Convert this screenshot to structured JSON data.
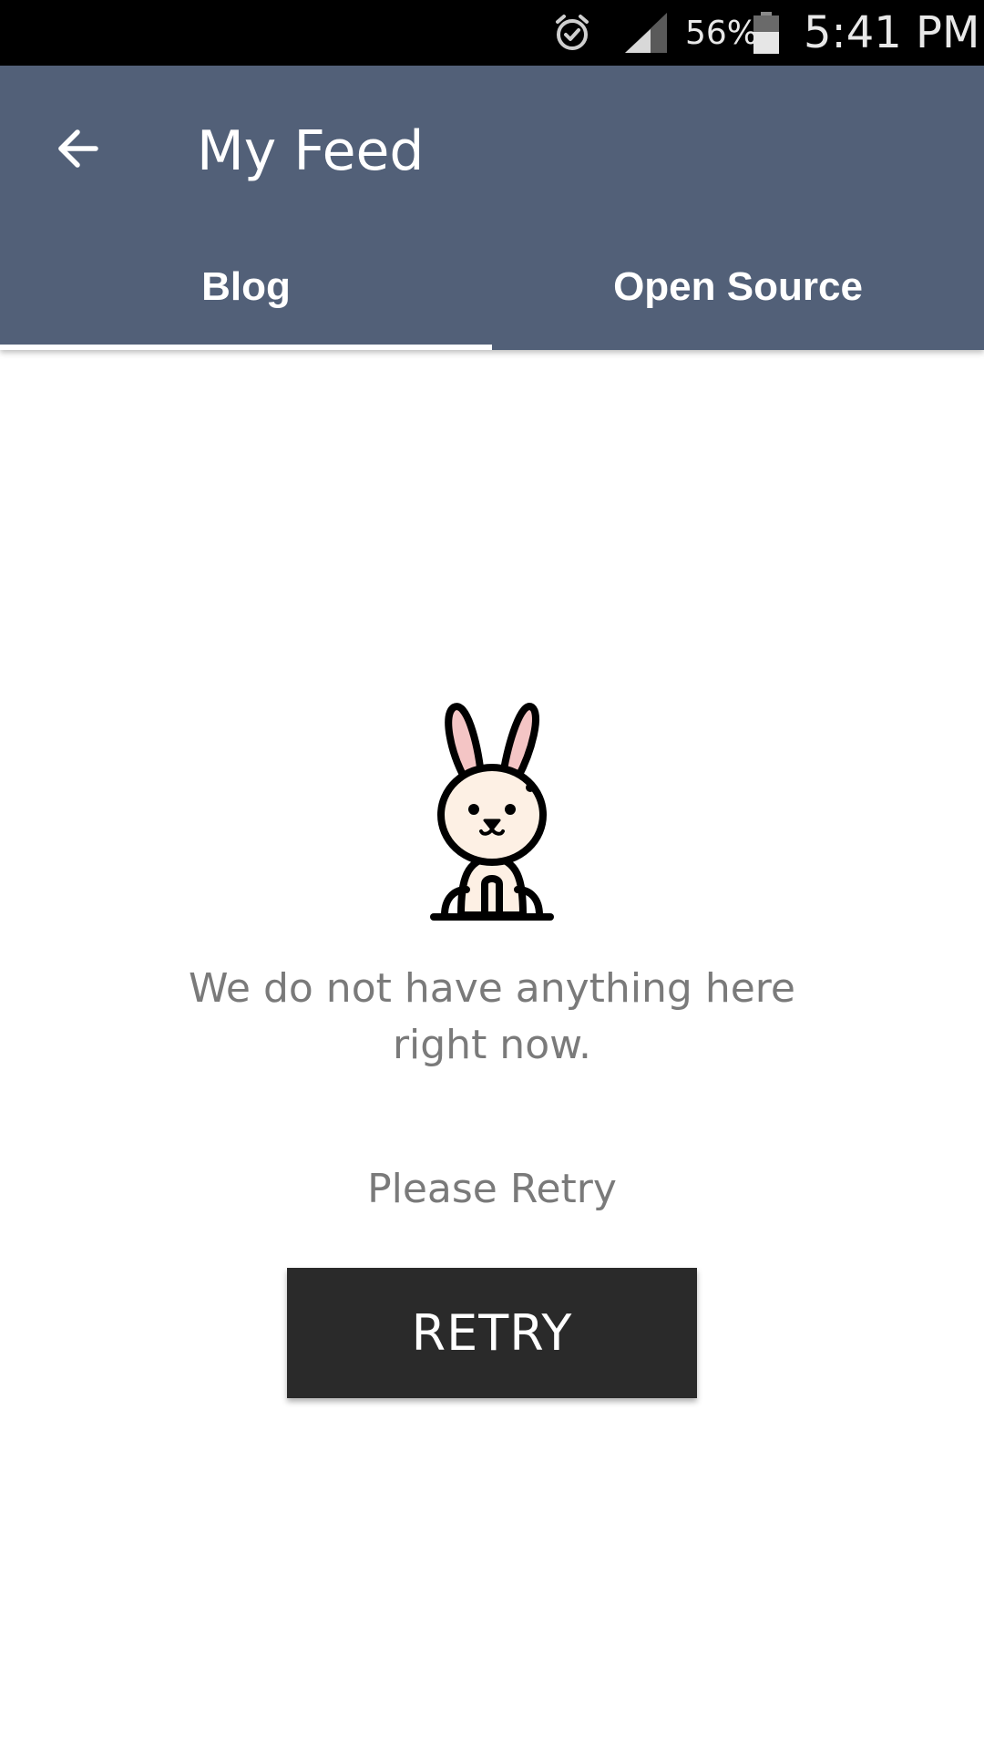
{
  "status_bar": {
    "alarm_icon": "alarm-clock-icon",
    "signal_icon": "cell-signal-icon",
    "battery_percent": "56%",
    "battery_level": 0.56,
    "battery_icon": "battery-icon",
    "time": "5:41 PM"
  },
  "app_bar": {
    "back_icon": "arrow-back-icon",
    "title": "My Feed",
    "background_color": "#526078"
  },
  "tabs": [
    {
      "label": "Blog",
      "selected": true
    },
    {
      "label": "Open Source",
      "selected": false
    }
  ],
  "empty_state": {
    "illustration_icon": "bunny-icon",
    "message": "We do not have anything here right now.",
    "retry_hint": "Please Retry",
    "retry_button_label": "RETRY"
  }
}
